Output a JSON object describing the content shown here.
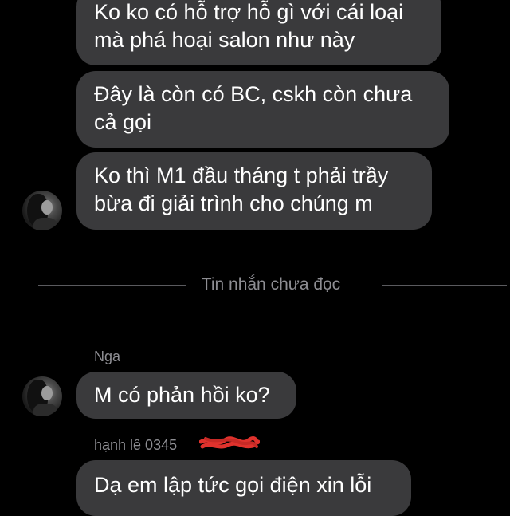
{
  "messages_top": [
    {
      "lines": [
        "Ko ko có hỗ trợ hỗ gì với cái loại",
        "mà phá hoại salon như này"
      ]
    },
    {
      "lines": [
        "Đây là còn có BC, cskh còn chưa",
        "cả gọi"
      ]
    },
    {
      "lines": [
        "Ko thì M1 đầu tháng t phải trầy",
        "bừa đi giải trình cho chúng m"
      ]
    }
  ],
  "divider": {
    "label": "Tin nhắn chưa đọc"
  },
  "thread_nga": {
    "sender": "Nga",
    "message": "M có phản hồi ko?"
  },
  "thread_hanh": {
    "sender": "hạnh lê 0345",
    "message": "Dạ em lập tức gọi điện xin lỗi"
  },
  "colors": {
    "background": "#000000",
    "bubble": "#3a3a3c",
    "secondary_text": "#8e8e93",
    "redaction": "#e0322d"
  },
  "icons": {
    "avatar": "profile-photo",
    "redaction": "red-scribble-redaction"
  }
}
